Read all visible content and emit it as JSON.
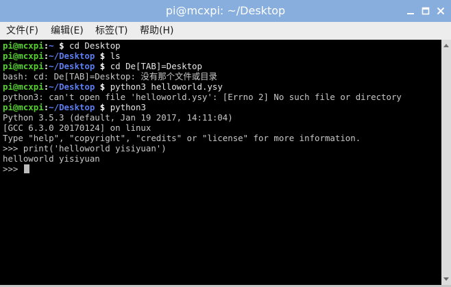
{
  "window": {
    "title": "pi@mcxpi: ~/Desktop"
  },
  "menu": [
    {
      "label": "文件(F)"
    },
    {
      "label": "编辑(E)"
    },
    {
      "label": "标签(T)"
    },
    {
      "label": "帮助(H)"
    }
  ],
  "terminal": {
    "prompt_user": "pi@mcxpi",
    "prompt_sep": ":",
    "prompt_dollar": "$",
    "dir_home": "~",
    "dir_desktop": "~/Desktop",
    "cmd1": "cd Desktop",
    "cmd2": "ls",
    "cmd3": "cd De[TAB]=Desktop",
    "out3": "bash: cd: De[TAB]=Desktop: 没有那个文件或目录",
    "cmd4": "python3 helloworld.ysy",
    "out4": "python3: can't open file 'helloworld.ysy': [Errno 2] No such file or directory",
    "cmd5": "python3",
    "py1": "Python 3.5.3 (default, Jan 19 2017, 14:11:04)",
    "py2": "[GCC 6.3.0 20170124] on linux",
    "py3": "Type \"help\", \"copyright\", \"credits\" or \"license\" for more information.",
    "py_prompt": ">>> ",
    "py_cmd": "print('helloworld yisiyuan')",
    "py_out": "helloworld yisiyuan"
  },
  "colors": {
    "title_bar": "#87aedc",
    "prompt_user": "#55d32f",
    "prompt_dir": "#5c7ef0"
  }
}
